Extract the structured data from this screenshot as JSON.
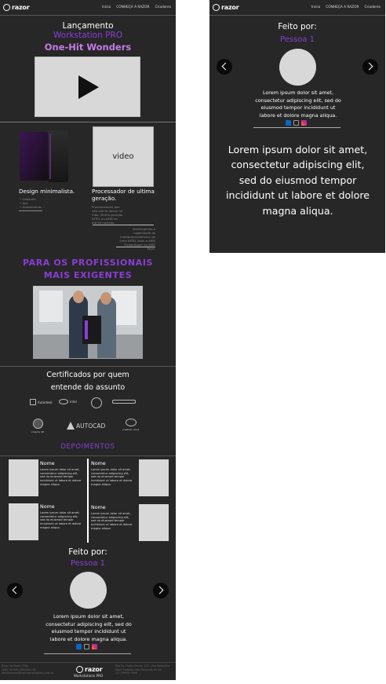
{
  "nav": {
    "logo_text": "razor",
    "links": [
      "Início",
      "CONHEÇA A RAZOR",
      "Criadores"
    ]
  },
  "hero": {
    "line1": "Lançamento",
    "line2": "Workstation PRO",
    "line3": "One-Hit Wonders"
  },
  "features": {
    "video_label": "video",
    "left_title": "Design minimalista.",
    "left_small": [
      "• Gabinete",
      "• Aço",
      "• Acabamento..."
    ],
    "right_title": "Processador de ultima geração.",
    "right_small": "Processadores que não vão te deixar na mão: última geração INTEL ou AMD de até 64 núcleos.",
    "right_small2": "Desempenho e capacidade de multiprocessamento de linha INTEL Xeon e AMD Threadripper ou AMD Epyc."
  },
  "pro": {
    "line1": "PARA OS PROFISSIONAIS",
    "line2": "MAIS EXIGENTES"
  },
  "certified": {
    "title_line1": "Certificados por quem",
    "title_line2": "entende do assunto",
    "logos": [
      "Autodesk",
      "intel",
      "Solidworks",
      "Pegasus",
      "cinema 4D",
      "AUTOCAD",
      "creative cloud"
    ]
  },
  "depoimentos": {
    "title": "DEPOIMENTOS",
    "items": [
      {
        "name": "Nome",
        "text": "Lorem ipsum dolor sit amet, consectetur adipiscing elit, sed do eiusmod tempor incididunt ut labore et dolore magna aliqua."
      },
      {
        "name": "Nome",
        "text": "Lorem ipsum dolor sit amet, consectetur adipiscing elit, sed do eiusmod tempor incididunt ut labore et dolore magna aliqua."
      },
      {
        "name": "Nome",
        "text": "Lorem ipsum dolor sit amet, consectetur adipiscing elit, sed do eiusmod tempor incididunt ut labore et dolore magna aliqua."
      },
      {
        "name": "Nome",
        "text": "Lorem ipsum dolor sit amet, consectetur adipiscing elit, sed do eiusmod tempor incididunt ut labore et dolore magna aliqua."
      }
    ]
  },
  "feito": {
    "title": "Feito por:",
    "person": "Pessoa 1",
    "bio": "Lorem ipsum dolor sit amet, consectetur adipiscing elit, sed do eiusmod tempor incididunt ut labore et dolore magna aliqua."
  },
  "footer": {
    "col1": [
      "Razor do Brasil LTDA",
      "CNPJ: 00.000.000/0001-00",
      "atendimento@razorworkstations.com.br"
    ],
    "sub": "Workstations PRO",
    "col2": [
      "Rua Dr. Flores Moura, 123 - Vila Madalena",
      "Nova Fazenda, São Fernando do Sul",
      "(11) 99999-9999"
    ]
  },
  "right_panel": {
    "big_text": "Lorem ipsum dolor sit amet, consectetur adipiscing elit, sed do eiusmod tempor incididunt ut labore et dolore magna aliqua."
  },
  "colors": {
    "background": "#272727",
    "accent_purple": "#8a3dd6",
    "accent_light": "#c77ae8"
  }
}
